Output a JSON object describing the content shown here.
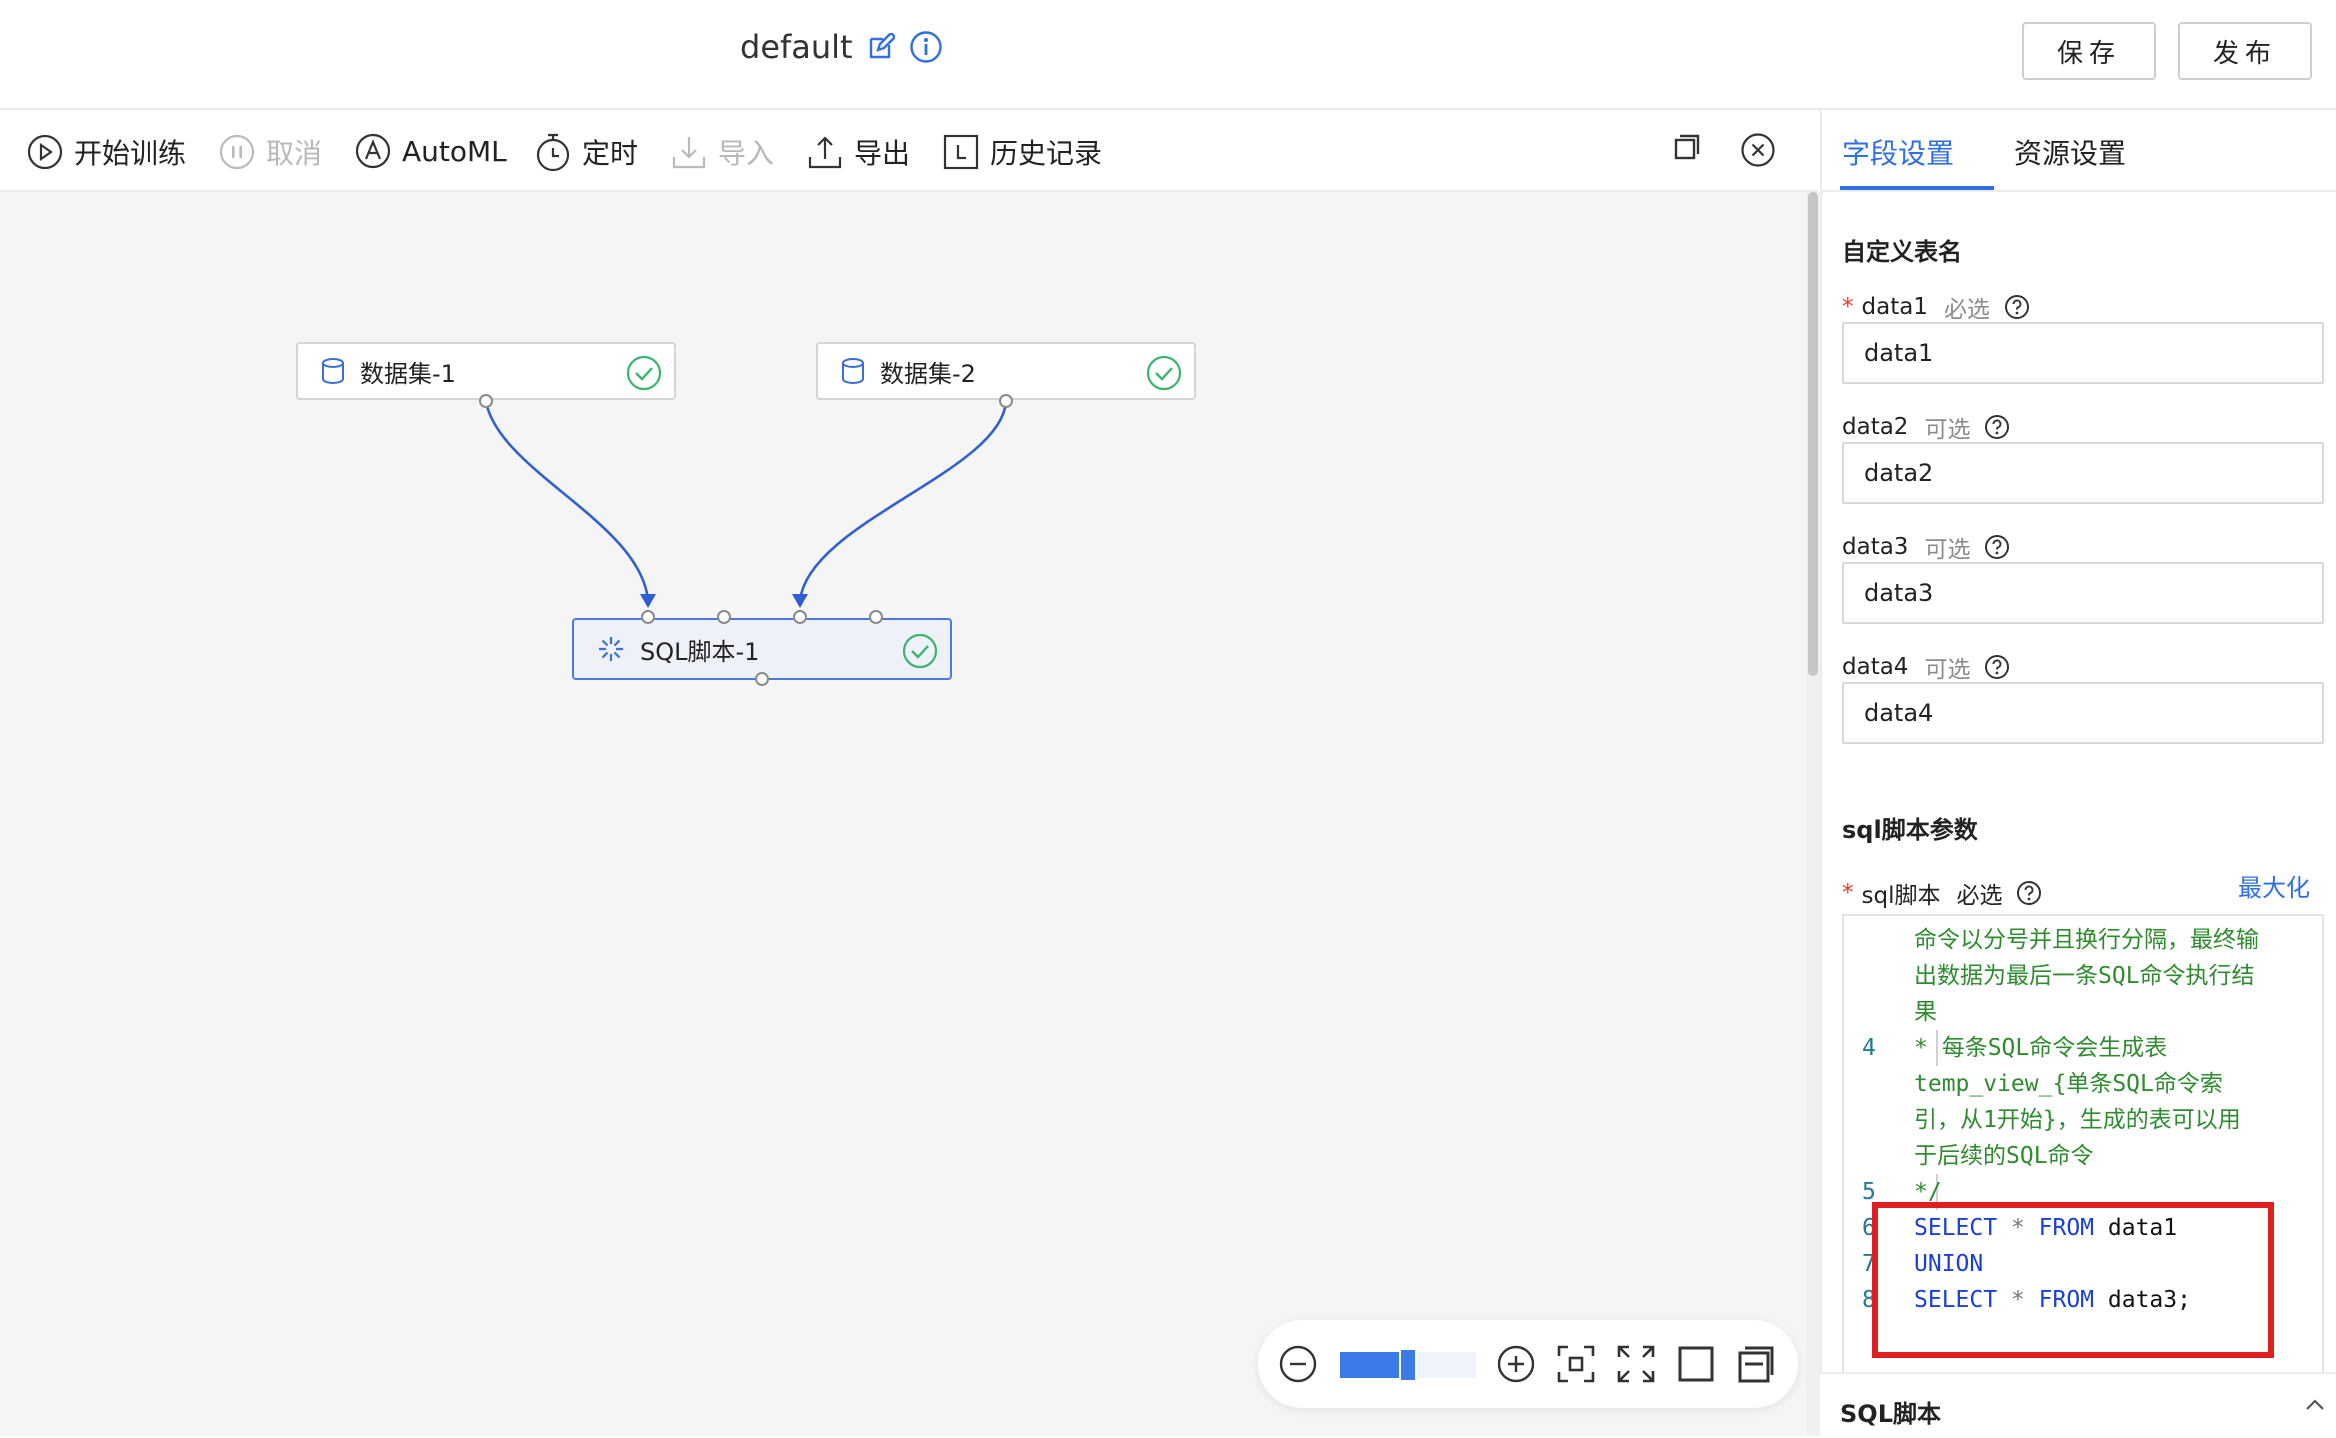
{
  "header": {
    "title": "default",
    "save_label": "保存",
    "publish_label": "发布"
  },
  "toolbar": {
    "start_training": "开始训练",
    "cancel": "取消",
    "automl": "AutoML",
    "schedule": "定时",
    "import": "导入",
    "export": "导出",
    "history": "历史记录"
  },
  "canvas": {
    "nodes": [
      {
        "label": "数据集-1",
        "status": "success"
      },
      {
        "label": "数据集-2",
        "status": "success"
      },
      {
        "label": "SQL脚本-1",
        "status": "success"
      }
    ],
    "zoom_level": 0.5
  },
  "panel": {
    "tabs": [
      "字段设置",
      "资源设置"
    ],
    "active_tab": "字段设置",
    "section_table_name": "自定义表名",
    "fields": [
      {
        "name": "data1",
        "flag": "必选",
        "value": "data1",
        "required": true
      },
      {
        "name": "data2",
        "flag": "可选",
        "value": "data2",
        "required": false
      },
      {
        "name": "data3",
        "flag": "可选",
        "value": "data3",
        "required": false
      },
      {
        "name": "data4",
        "flag": "可选",
        "value": "data4",
        "required": false
      }
    ],
    "section_sql_params": "sql脚本参数",
    "sql_field": {
      "name": "sql脚本",
      "flag": "必选",
      "maximize": "最大化"
    },
    "code": {
      "l3_a": "命令以分号并且换行分隔，最终输",
      "l3_b": "出数据为最后一条SQL命令执行结",
      "l3_c": "果",
      "l4_num": "4",
      "l4_a": "  * 每条SQL命令会生成表",
      "l4_b": "temp_view_{单条SQL命令索",
      "l4_c": "引，从1开始}，生成的表可以用",
      "l4_d": "于后续的SQL命令",
      "l5_num": "5",
      "l5_a": "  */",
      "l6_num": "6",
      "l6_kw1": "SELECT",
      "l6_op": " * ",
      "l6_kw2": "FROM",
      "l6_id": " data1",
      "l7_num": "7",
      "l7_kw": "UNION",
      "l8_num": "8",
      "l8_kw1": "SELECT",
      "l8_op": " * ",
      "l8_kw2": "FROM",
      "l8_id": " data3;"
    },
    "accordion_label": "SQL脚本"
  },
  "colors": {
    "accent": "#2f6fe0",
    "success": "#3cb371",
    "edge": "#2f5fd0",
    "highlight_box": "#e02020"
  }
}
